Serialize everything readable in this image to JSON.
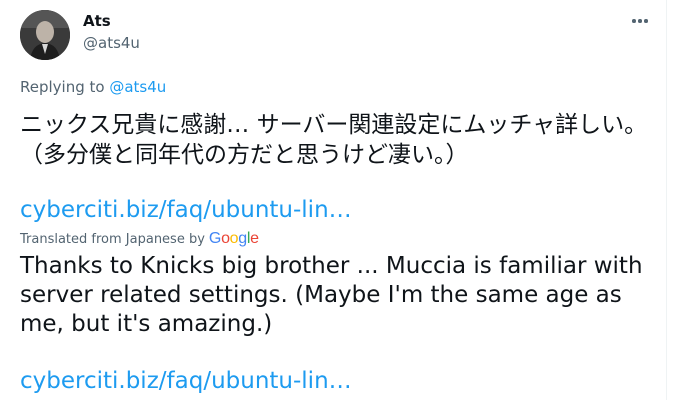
{
  "tweet": {
    "author_name": "Ats",
    "author_handle": "@ats4u",
    "replying_prefix": "Replying to ",
    "replying_to": "@ats4u",
    "original_text": "ニックス兄貴に感謝… サーバー関連設定にムッチャ詳しい。（多分僕と同年代の方だと思うけど凄い。）",
    "link_text": "cyberciti.biz/faq/ubuntu-lin…",
    "translated_label": "Translated from Japanese by",
    "google_logo_text": "Google",
    "translation_text": "Thanks to Knicks big brother ... Muccia is familiar with server related settings. (Maybe I'm the same age as me, but it's amazing.)",
    "translation_link_text": "cyberciti.biz/faq/ubuntu-lin…"
  },
  "colors": {
    "link": "#1d9bf0",
    "secondary_text": "#536471",
    "primary_text": "#0f1419"
  },
  "icons": {
    "more": "more-horizontal-icon"
  }
}
